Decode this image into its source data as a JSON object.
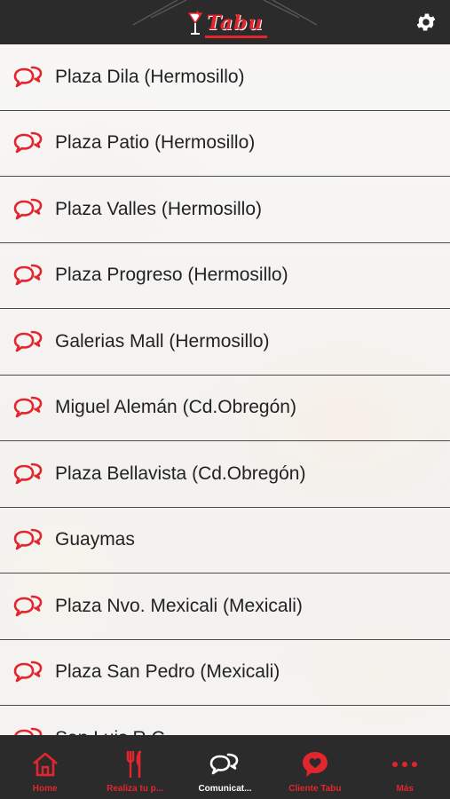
{
  "header": {
    "logo_text": "Tabu",
    "settings_icon": "gear-icon"
  },
  "locations": [
    {
      "label": "Plaza Dila (Hermosillo)"
    },
    {
      "label": "Plaza Patio (Hermosillo)"
    },
    {
      "label": "Plaza Valles (Hermosillo)"
    },
    {
      "label": "Plaza Progreso (Hermosillo)"
    },
    {
      "label": "Galerias Mall (Hermosillo)"
    },
    {
      "label": "Miguel Alemán (Cd.Obregón)"
    },
    {
      "label": "Plaza Bellavista (Cd.Obregón)"
    },
    {
      "label": "Guaymas"
    },
    {
      "label": "Plaza Nvo. Mexicali (Mexicali)"
    },
    {
      "label": "Plaza San Pedro (Mexicali)"
    },
    {
      "label": "San Luis R.C."
    }
  ],
  "row_icon": "chat-bubbles-icon",
  "tabs": [
    {
      "label": "Home",
      "icon": "home-icon",
      "active": false
    },
    {
      "label": "Realiza tu p...",
      "icon": "fork-knife-icon",
      "active": false
    },
    {
      "label": "Comunicat...",
      "icon": "chat-bubbles-icon",
      "active": true
    },
    {
      "label": "Cliente Tabu",
      "icon": "heart-bubble-icon",
      "active": false
    },
    {
      "label": "Más",
      "icon": "more-dots-icon",
      "active": false
    }
  ],
  "colors": {
    "accent": "#e3262e",
    "bar_background": "#2b2b2b",
    "active_tab_label": "#ffffff"
  }
}
